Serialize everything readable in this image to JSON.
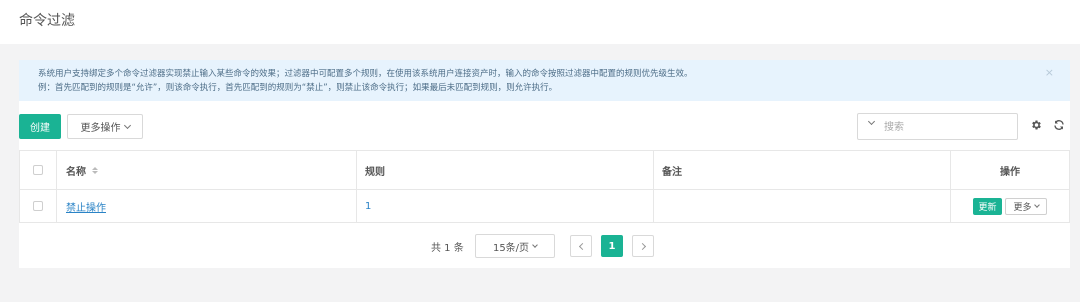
{
  "page": {
    "title": "命令过滤"
  },
  "alert": {
    "line1": "系统用户支持绑定多个命令过滤器实现禁止输入某些命令的效果；过滤器中可配置多个规则，在使用该系统用户连接资产时，输入的命令按照过滤器中配置的规则优先级生效。",
    "line2": "例：首先匹配到的规则是“允许”，则该命令执行，首先匹配到的规则为“禁止”，则禁止该命令执行；如果最后未匹配到规则，则允许执行。",
    "close": "×"
  },
  "toolbar": {
    "create_label": "创建",
    "more_actions_label": "更多操作",
    "search_placeholder": "搜索",
    "settings_icon": "gear-icon",
    "refresh_icon": "refresh-icon"
  },
  "table": {
    "headers": {
      "name": "名称",
      "rule": "规则",
      "comment": "备注",
      "actions": "操作"
    },
    "rows": [
      {
        "name": "禁止操作",
        "rule": "1",
        "comment": "",
        "update_label": "更新",
        "more_label": "更多"
      }
    ]
  },
  "pagination": {
    "total": "共 1 条",
    "page_size": "15条/页",
    "current_page": "1"
  },
  "colors": {
    "accent": "#1ab394",
    "link": "#2a83c6",
    "alert_bg": "#e7f3fd"
  }
}
